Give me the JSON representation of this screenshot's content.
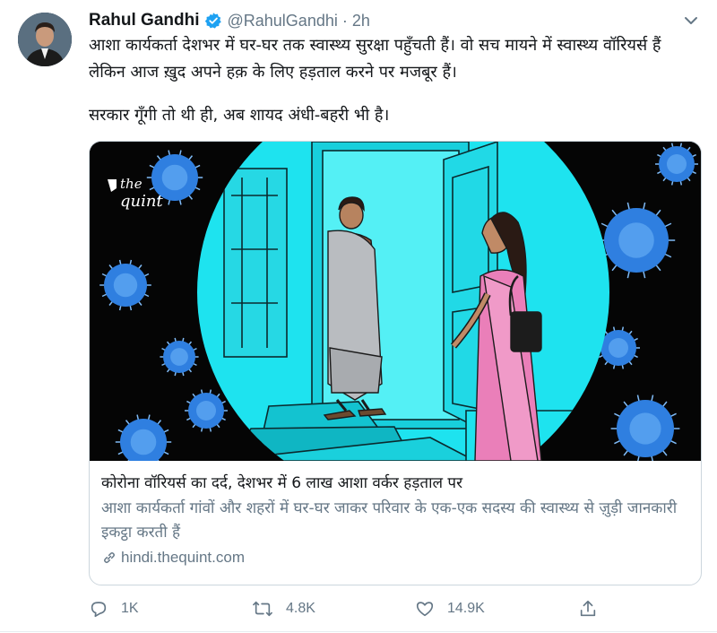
{
  "author": {
    "name": "Rahul Gandhi",
    "handle": "@RahulGandhi",
    "separator": "·",
    "time": "2h"
  },
  "tweet": {
    "line1": "आशा कार्यकर्ता देशभर में घर-घर तक स्वास्थ्य सुरक्षा पहुँचती हैं। वो सच मायने में स्वास्थ्य वॉरियर्स हैं लेकिन आज ख़ुद अपने हक़ के लिए हड़ताल करने पर मजबूर हैं।",
    "line2": "सरकार गूँगी तो थी ही, अब शायद अंधी-बहरी भी है।"
  },
  "card": {
    "logo_line1": "the",
    "logo_line2": "quint",
    "title": "कोरोना वॉरियर्स का दर्द, देशभर में 6 लाख आशा वर्कर हड़ताल पर",
    "description": "आशा कार्यकर्ता गांवों और शहरों में घर-घर जाकर परिवार के एक-एक सदस्य की स्वास्थ्य से ज़ुड़ी जानकारी इकट्ठा करती हैं",
    "domain": "hindi.thequint.com"
  },
  "actions": {
    "reply_count": "1K",
    "retweet_count": "4.8K",
    "like_count": "14.9K"
  },
  "colors": {
    "verified": "#1da1f2",
    "secondary_text": "#657786",
    "card_border": "#ccd6dd",
    "illustration_cyan": "#1ee3ef",
    "virus_blue": "#2f7fe0"
  },
  "icons": [
    "verified-badge-icon",
    "chevron-down-icon",
    "link-icon",
    "reply-icon",
    "retweet-icon",
    "like-icon",
    "share-icon"
  ]
}
